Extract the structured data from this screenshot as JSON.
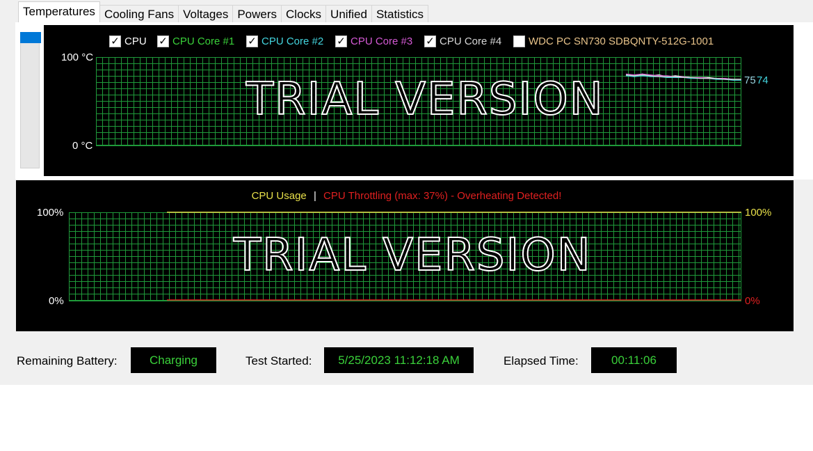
{
  "tabs": [
    "Temperatures",
    "Cooling Fans",
    "Voltages",
    "Powers",
    "Clocks",
    "Unified",
    "Statistics"
  ],
  "active_tab": "Temperatures",
  "temperature_chart": {
    "legend": [
      {
        "label": "CPU",
        "checked": true,
        "color": "#ffffff"
      },
      {
        "label": "CPU Core #1",
        "checked": true,
        "color": "#3ad13a"
      },
      {
        "label": "CPU Core #2",
        "checked": true,
        "color": "#44d6e0"
      },
      {
        "label": "CPU Core #3",
        "checked": true,
        "color": "#d65ad6"
      },
      {
        "label": "CPU Core #4",
        "checked": true,
        "color": "#d8d8d8"
      },
      {
        "label": "WDC PC SN730 SDBQNTY-512G-1001",
        "checked": false,
        "color": "#e8c38a"
      }
    ],
    "y_max_label": "100 °C",
    "y_min_label": "0 °C",
    "watermark": "TRIAL VERSION",
    "current_value_labels": [
      "75",
      "75",
      "74"
    ],
    "y_range": [
      0,
      100
    ]
  },
  "usage_chart": {
    "title_usage": "CPU Usage",
    "separator": "|",
    "title_throttling": "CPU Throttling (max: 37%) - Overheating Detected!",
    "left_max_label": "100%",
    "left_min_label": "0%",
    "right_max_label": "100%",
    "right_min_label": "0%",
    "watermark": "TRIAL VERSION",
    "usage_color": "#e8e04a",
    "throttling_color": "#e02020"
  },
  "status": {
    "battery_label": "Remaining Battery:",
    "battery_value": "Charging",
    "test_started_label": "Test Started:",
    "test_started_value": "5/25/2023 11:12:18 AM",
    "elapsed_label": "Elapsed Time:",
    "elapsed_value": "00:11:06"
  },
  "chart_data": {
    "type": "line",
    "ylim": [
      0,
      100
    ],
    "series": [
      {
        "name": "CPU",
        "values": [
          80,
          79,
          81,
          79,
          80,
          78,
          79,
          78,
          77,
          77,
          77,
          76,
          76,
          75,
          75
        ]
      },
      {
        "name": "CPU Core #1",
        "values": [
          80,
          79,
          80,
          79,
          79,
          78,
          78,
          77,
          77,
          77,
          76,
          76,
          75,
          75,
          75
        ]
      },
      {
        "name": "CPU Core #2",
        "values": [
          79,
          78,
          79,
          78,
          78,
          77,
          77,
          77,
          76,
          76,
          76,
          75,
          75,
          74,
          74
        ]
      },
      {
        "name": "CPU Core #3",
        "values": [
          81,
          80,
          81,
          80,
          79,
          79,
          78,
          78,
          77,
          77,
          76,
          76,
          76,
          75,
          75
        ]
      },
      {
        "name": "CPU Core #4",
        "values": [
          80,
          79,
          80,
          79,
          78,
          78,
          78,
          77,
          77,
          76,
          76,
          76,
          75,
          75,
          75
        ]
      }
    ]
  }
}
